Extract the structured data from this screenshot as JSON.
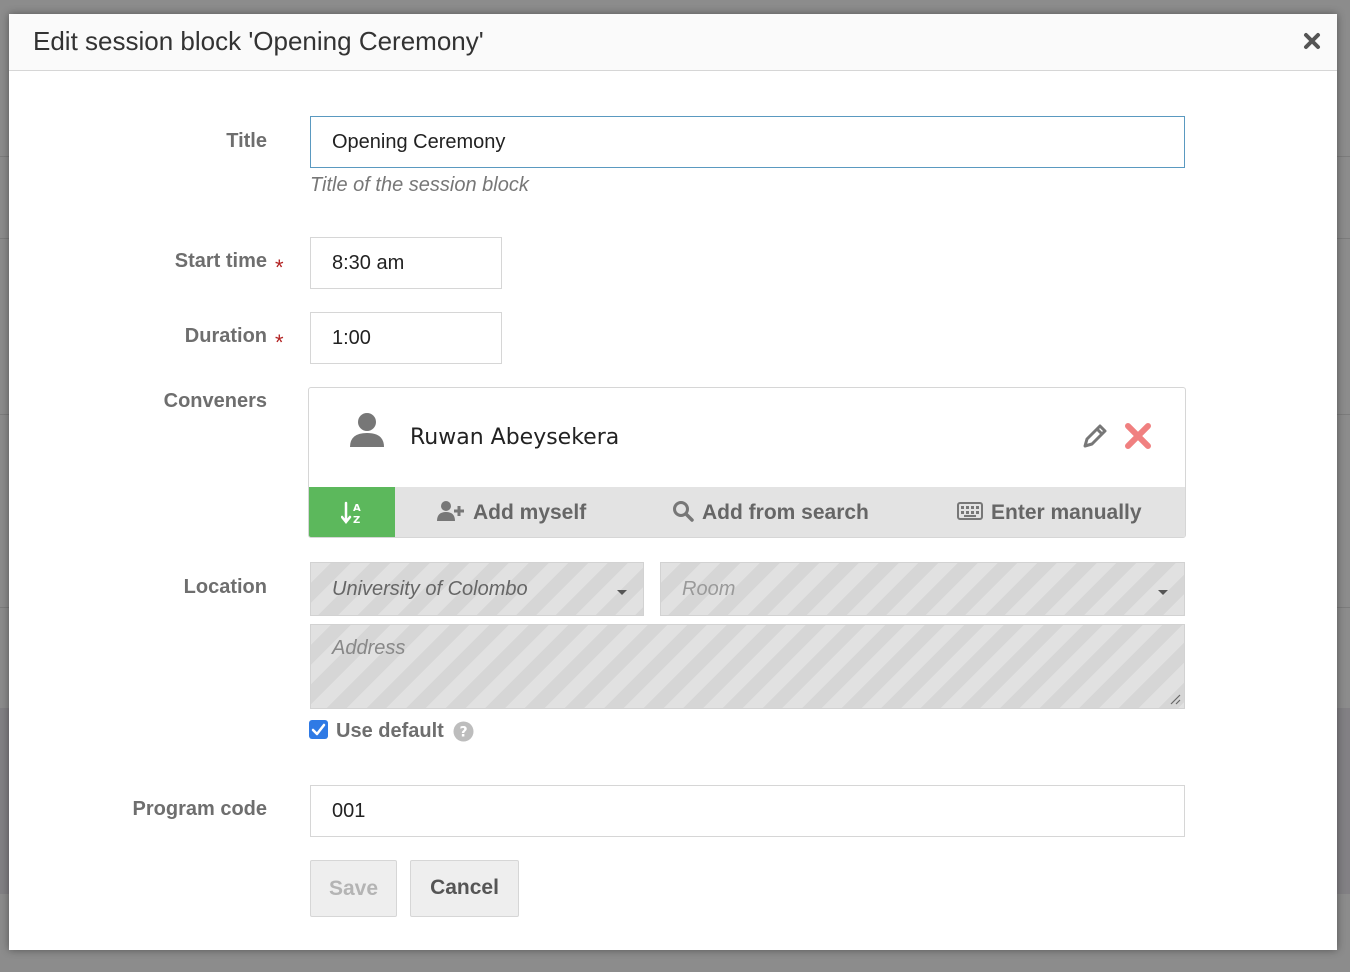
{
  "dialog": {
    "title": "Edit session block 'Opening Ceremony'"
  },
  "form": {
    "title": {
      "label": "Title",
      "value": "Opening Ceremony",
      "hint": "Title of the session block"
    },
    "start_time": {
      "label": "Start time",
      "required_marker": "*",
      "value": "8:30 am"
    },
    "duration": {
      "label": "Duration",
      "required_marker": "*",
      "value": "1:00"
    },
    "conveners": {
      "label": "Conveners",
      "people": [
        {
          "name": "Ruwan Abeysekera"
        }
      ],
      "toolbar": {
        "add_myself": "Add myself",
        "add_from_search": "Add from search",
        "enter_manually": "Enter manually"
      },
      "sort_active_color": "#5cb85c"
    },
    "location": {
      "label": "Location",
      "venue": "University of Colombo",
      "room_placeholder": "Room",
      "address_placeholder": "Address",
      "use_default_label": "Use default",
      "use_default_checked": true
    },
    "program_code": {
      "label": "Program code",
      "value": "001"
    },
    "buttons": {
      "save": "Save",
      "cancel": "Cancel"
    }
  },
  "colors": {
    "focus_border": "#5a99c0",
    "required": "#b22222",
    "remove_icon": "#f08080",
    "checkbox": "#2f7ae5"
  },
  "icons": {
    "close": "close-icon",
    "person": "person-icon",
    "edit": "pencil-icon",
    "remove": "x-icon",
    "sort": "sort-alpha-icon",
    "add_user": "user-plus-icon",
    "search": "search-icon",
    "keyboard": "keyboard-icon",
    "help": "question-circle-icon"
  }
}
